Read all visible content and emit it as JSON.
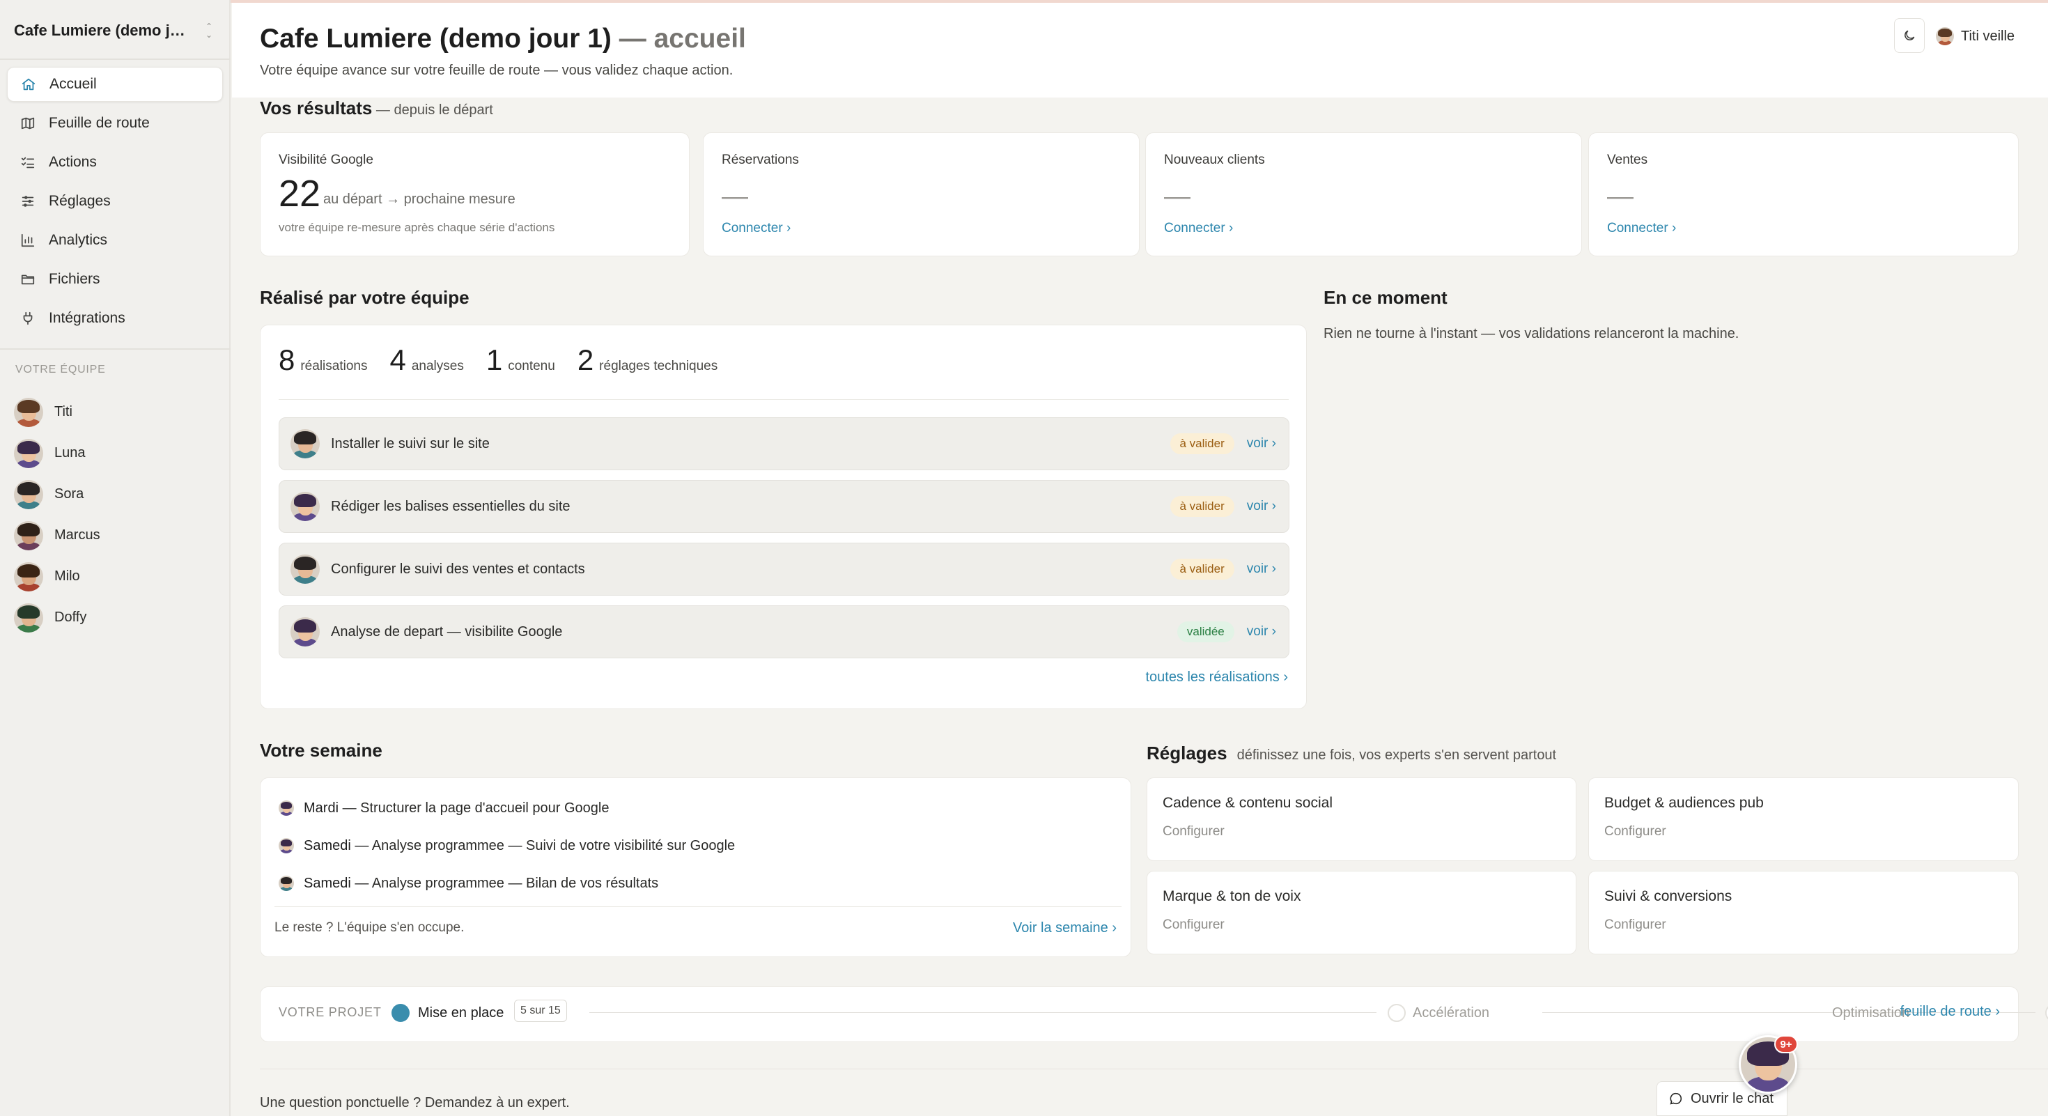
{
  "workspace": {
    "name": "Cafe Lumiere (demo jou…"
  },
  "sidebar": {
    "items": [
      {
        "label": "Accueil",
        "icon": "home-icon",
        "active": true
      },
      {
        "label": "Feuille de route",
        "icon": "map-icon"
      },
      {
        "label": "Actions",
        "icon": "list-checks-icon"
      },
      {
        "label": "Réglages",
        "icon": "sliders-icon"
      },
      {
        "label": "Analytics",
        "icon": "bar-chart-icon"
      },
      {
        "label": "Fichiers",
        "icon": "folder-icon"
      },
      {
        "label": "Intégrations",
        "icon": "plug-icon"
      }
    ],
    "team_title": "VOTRE ÉQUIPE",
    "team": [
      {
        "name": "Titi",
        "skin": "#e9bd99",
        "hair": "#5b3a24",
        "shirt": "#b35a3c"
      },
      {
        "name": "Luna",
        "skin": "#edc3a0",
        "hair": "#3b2a4a",
        "shirt": "#5d4b8c"
      },
      {
        "name": "Sora",
        "skin": "#e6b996",
        "hair": "#2a2524",
        "shirt": "#3e7f8a"
      },
      {
        "name": "Marcus",
        "skin": "#c99472",
        "hair": "#2f2118",
        "shirt": "#6b3e5a"
      },
      {
        "name": "Milo",
        "skin": "#d9a57f",
        "hair": "#3a2414",
        "shirt": "#a8422f"
      },
      {
        "name": "Doffy",
        "skin": "#e3b48f",
        "hair": "#263a2a",
        "shirt": "#3c7b4a"
      }
    ]
  },
  "header": {
    "title": "Cafe Lumiere (demo jour 1)",
    "title_suffix": " — accueil",
    "subtitle": "Votre équipe avance sur votre feuille de route — vous validez chaque action.",
    "user": "Titi veille"
  },
  "results": {
    "title": "Vos résultats",
    "subtitle": " — depuis le départ",
    "kpis": [
      {
        "label": "Visibilité Google",
        "value": "22",
        "after": "au départ → prochaine mesure",
        "note": "votre équipe re-mesure après chaque série d'actions"
      },
      {
        "label": "Réservations",
        "value": "—",
        "link": "Connecter ›"
      },
      {
        "label": "Nouveaux clients",
        "value": "—",
        "link": "Connecter ›"
      },
      {
        "label": "Ventes",
        "value": "—",
        "link": "Connecter ›"
      }
    ]
  },
  "realised": {
    "title": "Réalisé par votre équipe",
    "stats": [
      {
        "n": "8",
        "label": "réalisations"
      },
      {
        "n": "4",
        "label": "analyses"
      },
      {
        "n": "1",
        "label": "contenu"
      },
      {
        "n": "2",
        "label": "réglages techniques"
      }
    ],
    "tasks": [
      {
        "label": "Installer le suivi sur le site",
        "status": "à valider",
        "kind": "pending",
        "action": "voir ›"
      },
      {
        "label": "Rédiger les balises essentielles du site",
        "status": "à valider",
        "kind": "pending",
        "action": "voir ›"
      },
      {
        "label": "Configurer le suivi des ventes et contacts",
        "status": "à valider",
        "kind": "pending",
        "action": "voir ›"
      },
      {
        "label": "Analyse de depart — visibilite Google",
        "status": "validée",
        "kind": "done",
        "action": "voir ›"
      }
    ],
    "all_link": "toutes les réalisations ›"
  },
  "now": {
    "title": "En ce moment",
    "text": "Rien ne tourne à l'instant — vos validations relanceront la machine."
  },
  "week": {
    "title": "Votre semaine",
    "items": [
      {
        "day": "Mardi",
        "text": " — Structurer la page d'accueil pour Google"
      },
      {
        "day": "Samedi",
        "text": " — Analyse programmee — Suivi de votre visibilité sur Google"
      },
      {
        "day": "Samedi",
        "text": " — Analyse programmee — Bilan de vos résultats"
      }
    ],
    "footer": "Le reste ? L'équipe s'en occupe.",
    "link": "Voir la semaine ›"
  },
  "settings": {
    "title": "Réglages",
    "subtitle": "définissez une fois, vos experts s'en servent partout",
    "cards": [
      {
        "name": "Cadence & contenu social",
        "cta": "Configurer"
      },
      {
        "name": "Budget & audiences pub",
        "cta": "Configurer"
      },
      {
        "name": "Marque & ton de voix",
        "cta": "Configurer"
      },
      {
        "name": "Suivi & conversions",
        "cta": "Configurer"
      }
    ]
  },
  "project": {
    "label": "VOTRE PROJET",
    "phases": [
      {
        "name": "Mise en place",
        "active": true
      },
      {
        "name": "Accélération",
        "active": false
      },
      {
        "name": "Optimisation",
        "active": false
      }
    ],
    "count": "5 sur 15",
    "link": "feuille de route ›"
  },
  "footer": {
    "question": "Une question ponctuelle ? Demandez à un expert.",
    "chat": "Ouvrir le chat",
    "badge": "9+"
  },
  "colors": {
    "accent": "#2c86ad",
    "pending": "#9a5d11",
    "done": "#2a7f43",
    "badge": "#e0463b"
  }
}
